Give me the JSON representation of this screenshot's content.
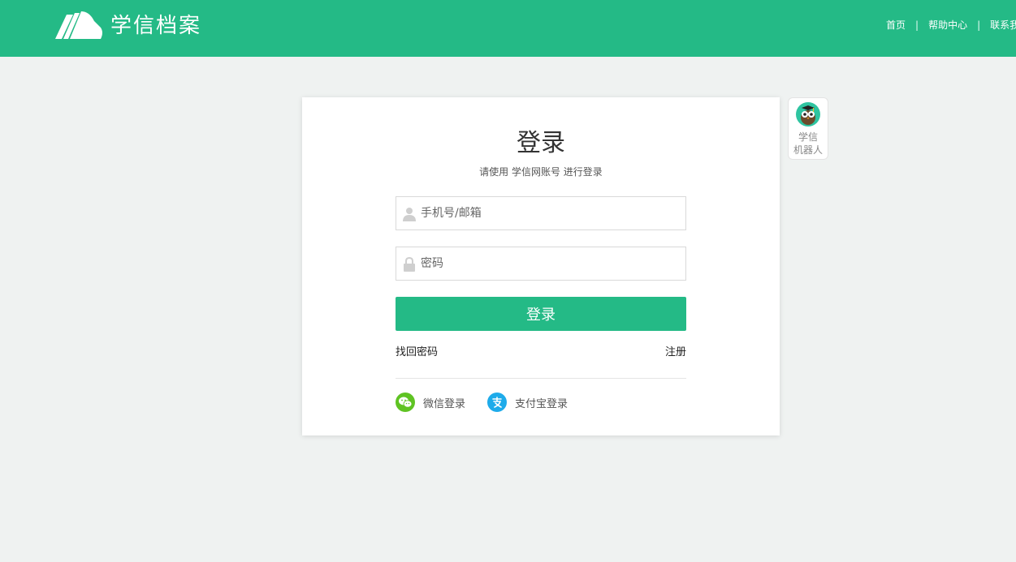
{
  "colors": {
    "brand_green": "#24ba86",
    "page_bg": "#eff2f1",
    "wechat_green": "#5fc323",
    "alipay_blue": "#1eabea"
  },
  "header": {
    "logo_icon": "book-pages-icon",
    "logo_text": "学信档案",
    "nav": {
      "home": "首页",
      "help": "帮助中心",
      "contact": "联系我",
      "separator": "|"
    }
  },
  "login": {
    "title": "登录",
    "subtitle": "请使用 学信网账号 进行登录",
    "username": {
      "icon": "user-icon",
      "placeholder": "手机号/邮箱",
      "value": ""
    },
    "password": {
      "icon": "lock-icon",
      "placeholder": "密码",
      "value": ""
    },
    "submit_label": "登录",
    "forgot_label": "找回密码",
    "register_label": "注册",
    "social": {
      "wechat": {
        "icon": "wechat-icon",
        "label": "微信登录"
      },
      "alipay": {
        "icon": "alipay-icon",
        "label": "支付宝登录"
      }
    }
  },
  "robot": {
    "icon": "robot-owl-icon",
    "label_line1": "学信",
    "label_line2": "机器人"
  }
}
